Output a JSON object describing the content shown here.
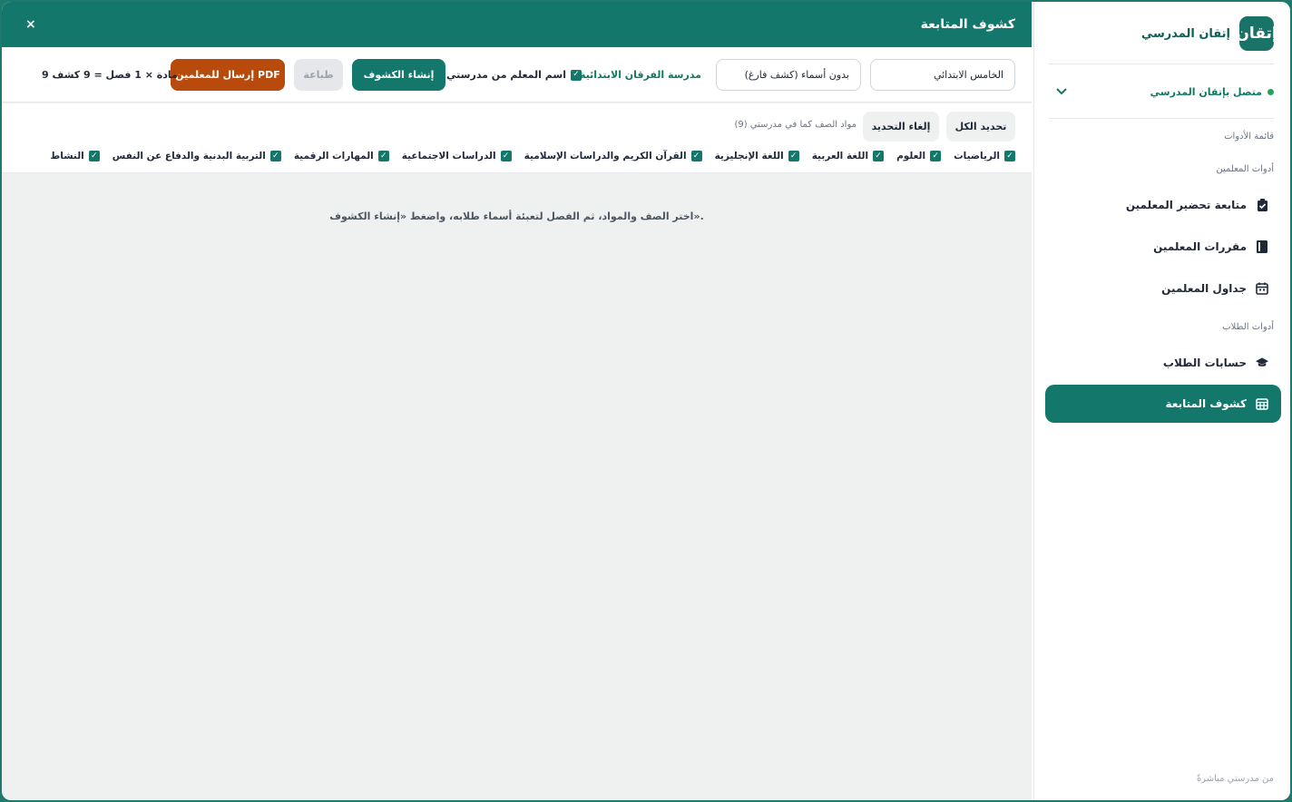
{
  "header": {
    "title": "كشوف المتابعة",
    "close": "×"
  },
  "toolbar": {
    "grade_select": "الخامس الابتدائي",
    "names_select": "بدون أسماء (كشف فارغ)",
    "school_name": "مدرسة الفرقان الابتدائية",
    "teacher_name_check": "اسم المعلم من مدرستي",
    "create_btn": "إنشاء الكشوف",
    "print_btn": "طباعة",
    "send_pdf_btn": "إرسال للمعلمين PDF",
    "summary": "9 مادة × 1 فصل = 9 كشف"
  },
  "subjects": {
    "select_all": "تحديد الكل",
    "deselect": "إلغاء التحديد",
    "note": "مواد الصف كما في مدرستي (9)",
    "items": [
      "الرياضيات",
      "العلوم",
      "اللغة العربية",
      "اللغة الإنجليزية",
      "القرآن الكريم والدراسات الإسلامية",
      "الدراسات الاجتماعية",
      "المهارات الرقمية",
      "التربية البدنية والدفاع عن النفس",
      "النشاط"
    ]
  },
  "hint": "اختر الصف والمواد، ثم الفصل لتعبئة أسماء طلابه، واضغط «إنشاء الكشوف».",
  "sidebar": {
    "logo": "إتقان",
    "brand": "إتقان المدرسي",
    "connection": "متصل بإتقان المدرسي",
    "tools_menu": "قائمة الأدوات",
    "teacher_tools": "أدوات المعلمين",
    "items": [
      {
        "label": "متابعة تحضير المعلمين",
        "icon": "clipboard-check-icon"
      },
      {
        "label": "مقررات المعلمين",
        "icon": "book-icon"
      },
      {
        "label": "جداول المعلمين",
        "icon": "calendar-icon"
      }
    ],
    "student_tools": "أدوات الطلاب",
    "student_items": [
      {
        "label": "حسابات الطلاب",
        "icon": "graduation-cap-icon"
      },
      {
        "label": "كشوف المتابعة",
        "icon": "table-icon"
      }
    ],
    "footer": "من مدرستي مباشرةً"
  }
}
